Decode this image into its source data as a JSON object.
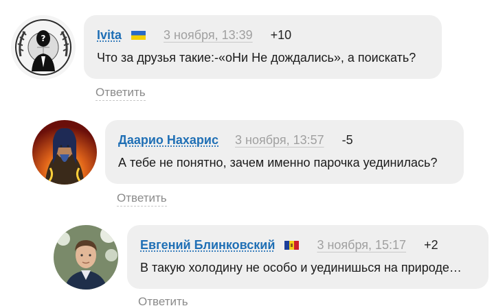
{
  "comments": [
    {
      "author": "Ivita",
      "flag": "ua-flag-icon",
      "date": "3 ноября, 13:39",
      "score": "+10",
      "text": "Что за друзья такие:-«оНи Не дождались», а поискать?",
      "reply_label": "Ответить",
      "avatar": "anonymous-mask-avatar"
    },
    {
      "author": "Даарио Нахарис",
      "date": "3 ноября, 13:57",
      "score": "-5",
      "text": "А тебе не понятно, зачем именно парочка уединилась?",
      "reply_label": "Ответить",
      "avatar": "dark-fantasy-character-avatar"
    },
    {
      "author": "Евгений Блинковский",
      "flag": "md-flag-icon",
      "date": "3 ноября, 15:17",
      "score": "+2",
      "text": "В такую холодину не особо и уединишься на природе…",
      "reply_label": "Ответить",
      "avatar": "man-portrait-avatar"
    }
  ],
  "colors": {
    "author_link": "#1f6fb5",
    "bubble_bg": "#efefef",
    "date_text": "#a0a0a0",
    "reply_text": "#8a8a8a"
  }
}
